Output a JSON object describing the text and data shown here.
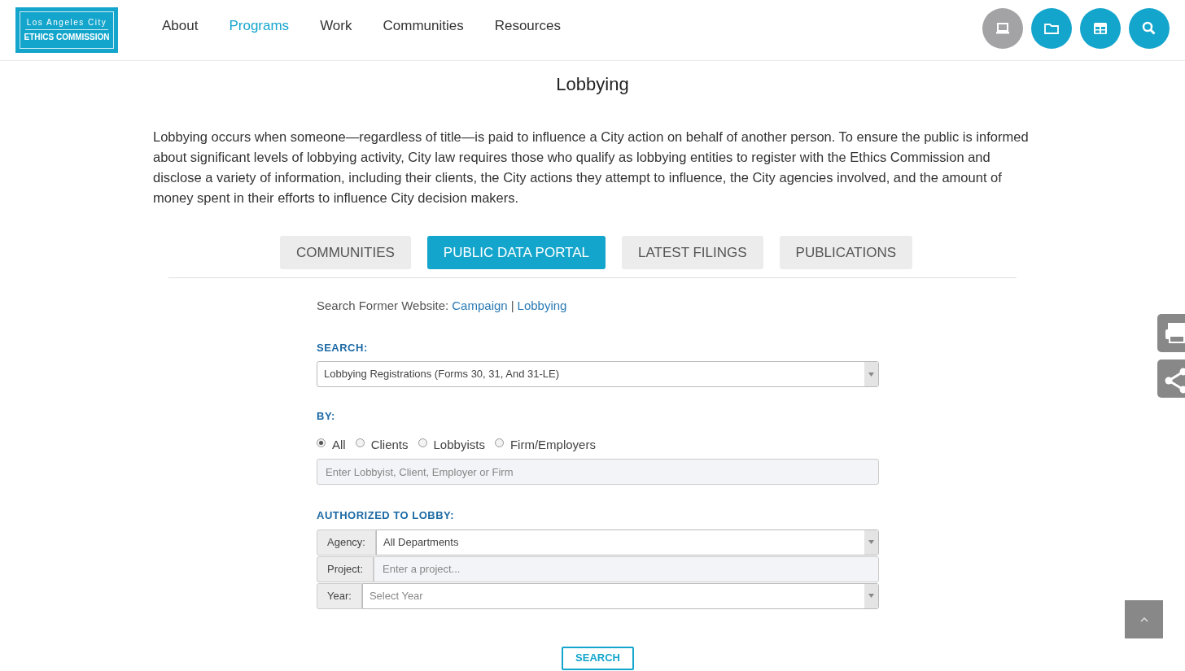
{
  "logo": {
    "line_1": "Los Angeles City",
    "line_2": "ETHICS COMMISSION"
  },
  "nav": [
    {
      "label": "About",
      "selected": false
    },
    {
      "label": "Programs",
      "selected": true
    },
    {
      "label": "Work",
      "selected": false
    },
    {
      "label": "Communities",
      "selected": false
    },
    {
      "label": "Resources",
      "selected": false
    }
  ],
  "header_buttons": [
    {
      "kind": "laptop",
      "selected": true
    },
    {
      "kind": "folder",
      "selected": false
    },
    {
      "kind": "grid",
      "selected": false
    },
    {
      "kind": "search",
      "selected": false
    }
  ],
  "title": "Lobbying",
  "intro": "Lobbying occurs when someone—regardless of title—is paid to influence a City action on behalf of another person. To ensure the public is informed about significant levels of lobbying activity, City law requires those who qualify as lobbying entities to register with the Ethics Commission and disclose a variety of information, including their clients, the City actions they attempt to influence, the City agencies involved, and the amount of money spent in their efforts to influence City decision makers.",
  "tabs": [
    {
      "label": "COMMUNITIES",
      "selected": false
    },
    {
      "label": "PUBLIC DATA PORTAL",
      "selected": true
    },
    {
      "label": "LATEST FILINGS",
      "selected": false
    },
    {
      "label": "PUBLICATIONS",
      "selected": false
    }
  ],
  "former_website": {
    "label": "Search Former Website:",
    "links": [
      "Campaign",
      "Lobbying"
    ],
    "separator": "|"
  },
  "search_label": "SEARCH:",
  "search_select": {
    "value": "Lobbying Registrations (Forms 30, 31, And 31-LE)"
  },
  "by_label": "BY:",
  "by_options": [
    {
      "label": "All",
      "selected": true
    },
    {
      "label": "Clients",
      "selected": false
    },
    {
      "label": "Lobbyists",
      "selected": false
    },
    {
      "label": "Firm/Employers",
      "selected": false
    }
  ],
  "name_field": {
    "placeholder": "Enter Lobbyist, Client, Employer or Firm"
  },
  "authorized_label": "AUTHORIZED TO LOBBY:",
  "authorized_rows": [
    {
      "kind": "select",
      "label": "Agency:",
      "value": "All Departments"
    },
    {
      "kind": "input",
      "label": "Project:",
      "placeholder": "Enter a project..."
    },
    {
      "kind": "select",
      "label": "Year:",
      "placeholder": "Select Year"
    }
  ],
  "search_button": "SEARCH",
  "side_buttons": [
    {
      "kind": "print"
    },
    {
      "kind": "share"
    }
  ]
}
